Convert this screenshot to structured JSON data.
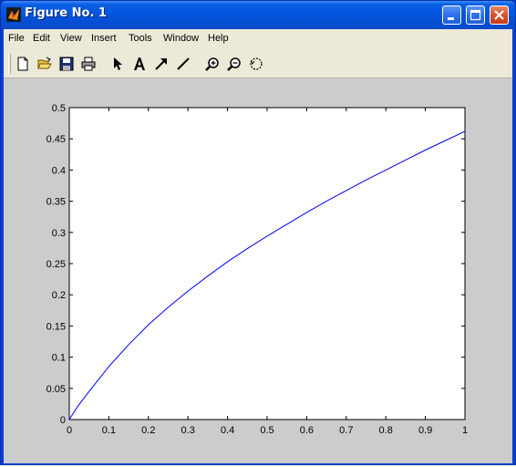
{
  "window": {
    "title": "Figure No. 1"
  },
  "menubar": {
    "items": [
      "File",
      "Edit",
      "View",
      "Insert",
      "Tools",
      "Window",
      "Help"
    ]
  },
  "toolbar": {
    "buttons": [
      "new-icon",
      "open-icon",
      "save-icon",
      "print-icon",
      "pointer-icon",
      "text-icon",
      "arrow-icon",
      "line-icon",
      "zoom-in-icon",
      "zoom-out-icon",
      "rotate-icon"
    ]
  },
  "colors": {
    "line": "#0000ff",
    "figure_bg": "#cccccc",
    "axes_bg": "#ffffff"
  },
  "chart_data": {
    "type": "line",
    "title": "",
    "xlabel": "",
    "ylabel": "",
    "xlim": [
      0,
      1
    ],
    "ylim": [
      0,
      0.5
    ],
    "xticks": [
      "0",
      "0.1",
      "0.2",
      "0.3",
      "0.4",
      "0.5",
      "0.6",
      "0.7",
      "0.8",
      "0.9",
      "1"
    ],
    "yticks": [
      "0",
      "0.05",
      "0.1",
      "0.15",
      "0.2",
      "0.25",
      "0.3",
      "0.35",
      "0.4",
      "0.45",
      "0.5"
    ],
    "grid": false,
    "series": [
      {
        "x": [
          0,
          0.02,
          0.05,
          0.1,
          0.15,
          0.2,
          0.25,
          0.3,
          0.35,
          0.4,
          0.45,
          0.5,
          0.55,
          0.6,
          0.65,
          0.7,
          0.75,
          0.8,
          0.85,
          0.9,
          0.95,
          1.0
        ],
        "y": [
          0,
          0.02,
          0.045,
          0.085,
          0.12,
          0.152,
          0.18,
          0.206,
          0.23,
          0.253,
          0.274,
          0.294,
          0.313,
          0.332,
          0.35,
          0.367,
          0.384,
          0.4,
          0.416,
          0.432,
          0.447,
          0.462
        ]
      }
    ]
  }
}
